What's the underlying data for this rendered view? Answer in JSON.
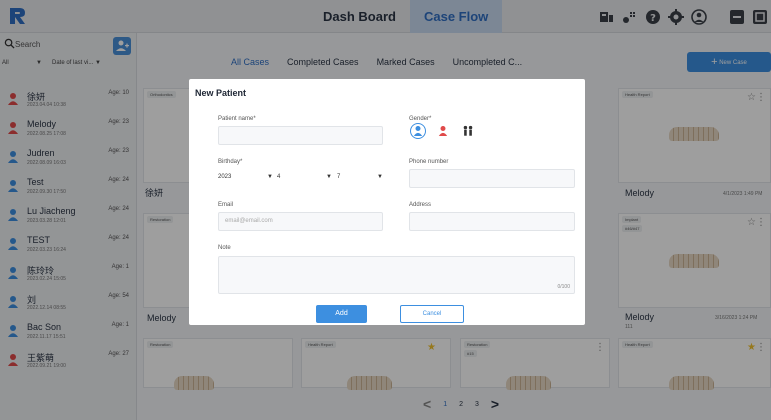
{
  "topbar": {
    "tabs": [
      {
        "label": "Dash Board",
        "active": false
      },
      {
        "label": "Case Flow",
        "active": true
      }
    ],
    "icons": [
      "scanner-icon",
      "connect-icon",
      "help-icon",
      "settings-icon",
      "account-icon",
      "minimize-icon",
      "maximize-icon"
    ]
  },
  "sidebar": {
    "search_placeholder": "Search",
    "filter_all": "All",
    "filter_sort": "Date of last vi...",
    "patients": [
      {
        "name": "徐妍",
        "date": "2023.04.04 10:38",
        "age": "Age: 10",
        "gender": "female"
      },
      {
        "name": "Melody",
        "date": "2022.08.25 17:08",
        "age": "Age: 23",
        "gender": "female"
      },
      {
        "name": "Judren",
        "date": "2022.08.09 16:03",
        "age": "Age: 23",
        "gender": "male"
      },
      {
        "name": "Test",
        "date": "2022.09.30 17:50",
        "age": "Age: 24",
        "gender": "male"
      },
      {
        "name": "Lu Jiacheng",
        "date": "2023.03.28 12:01",
        "age": "Age: 24",
        "gender": "male"
      },
      {
        "name": "TEST",
        "date": "2022.03.23 16:24",
        "age": "Age: 24",
        "gender": "male"
      },
      {
        "name": "陈玲玲",
        "date": "2023.02.24 15:05",
        "age": "Age: 1",
        "gender": "male"
      },
      {
        "name": "刘",
        "date": "2022.12.14 08:55",
        "age": "Age: 54",
        "gender": "male"
      },
      {
        "name": "Bac Son",
        "date": "2022.11.17 15:51",
        "age": "Age: 1",
        "gender": "male"
      },
      {
        "name": "王紫萌",
        "date": "2022.09.21 19:00",
        "age": "Age: 27",
        "gender": "female"
      }
    ]
  },
  "main": {
    "tabs": [
      {
        "label": "All Cases",
        "active": true
      },
      {
        "label": "Completed Cases",
        "active": false
      },
      {
        "label": "Marked Cases",
        "active": false
      },
      {
        "label": "Uncompleted C...",
        "active": false
      }
    ],
    "new_case_label": "New Case",
    "cards": {
      "c1_tag": "Orthodontics",
      "c1_name": "徐妍",
      "c2_tag": "Health Report",
      "c2_name": "Melody",
      "c2_date": "4/1/2023 1:49 PM",
      "c3_tag": "Restoration",
      "c3_name": "Melody",
      "c4_tag": "Implant",
      "c4_tag2": "#46/#47",
      "c4_name": "Melody",
      "c4_sub": "111",
      "c4_date": "3/16/2023 1:24 PM",
      "c5_tag": "Restoration",
      "c6_tag": "Health Report",
      "c7_tag": "Restoration",
      "c7_tag2": "#15",
      "c8_tag": "Health Report"
    },
    "pagination": {
      "pages": [
        "1",
        "2",
        "3"
      ],
      "active": "1"
    }
  },
  "modal": {
    "title": "New Patient",
    "patient_name_label": "Patient name*",
    "gender_label": "Gender*",
    "birthday_label": "Birthday*",
    "birthday_year": "2023",
    "birthday_month": "4",
    "birthday_day": "7",
    "phone_label": "Phone number",
    "email_label": "Email",
    "email_placeholder": "email@email.com",
    "address_label": "Address",
    "note_label": "Note",
    "note_counter": "0/100",
    "add_label": "Add",
    "cancel_label": "Cancel"
  },
  "colors": {
    "accent": "#3d8fe0",
    "male": "#3d8fe0",
    "female": "#e04a4a",
    "star_marked": "#f2c230"
  }
}
